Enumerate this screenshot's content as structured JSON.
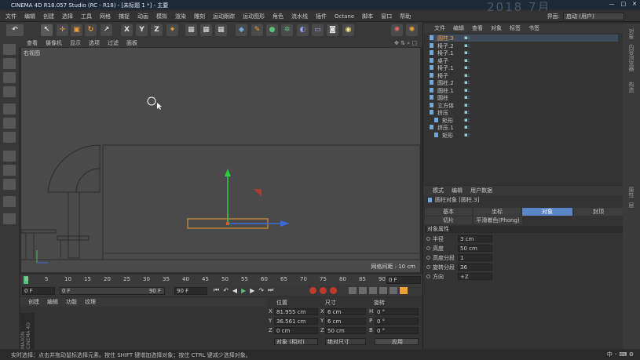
{
  "window": {
    "title": "CINEMA 4D R18.057 Studio (RC - R18) - [未标题 1 *] - 主要",
    "deco": "2018 7月"
  },
  "menu": [
    "文件",
    "编辑",
    "创建",
    "选择",
    "工具",
    "网格",
    "捕捉",
    "动画",
    "模拟",
    "渲染",
    "雕刻",
    "运动跟踪",
    "运动图形",
    "角色",
    "流水线",
    "插件",
    "Octane",
    "脚本",
    "窗口",
    "帮助"
  ],
  "layout": {
    "label": "界面:",
    "value": "启动 (用户)"
  },
  "toolbar_letters": [
    "X",
    "Y",
    "Z"
  ],
  "viewport": {
    "menu": [
      "查看",
      "摄像机",
      "显示",
      "选项",
      "过滤",
      "面板"
    ],
    "name": "右视图",
    "grid_info": "网格间距 : 10 cm"
  },
  "timeline": {
    "ticks": [
      "0",
      "5",
      "10",
      "15",
      "20",
      "25",
      "30",
      "35",
      "40",
      "45",
      "50",
      "55",
      "60",
      "65",
      "70",
      "75",
      "80",
      "85",
      "90"
    ],
    "current": "0 F",
    "start": "0 F",
    "slider_start": "0 F",
    "slider_end": "90 F",
    "end": "90 F"
  },
  "materials": {
    "menu": [
      "创建",
      "编辑",
      "功能",
      "纹理"
    ]
  },
  "coords": {
    "headers": [
      "位置",
      "尺寸",
      "旋转"
    ],
    "rows": [
      {
        "axis": "X",
        "pos": "81.955 cm",
        "size_axis": "X",
        "size": "6 cm",
        "rot_axis": "H",
        "rot": "0 °"
      },
      {
        "axis": "Y",
        "pos": "36.561 cm",
        "size_axis": "Y",
        "size": "6 cm",
        "rot_axis": "P",
        "rot": "0 °"
      },
      {
        "axis": "Z",
        "pos": "0 cm",
        "size_axis": "Z",
        "size": "50 cm",
        "rot_axis": "B",
        "rot": "0 °"
      }
    ],
    "mode": "对象 (相对)",
    "size_mode": "绝对尺寸",
    "apply": "应用"
  },
  "objects": {
    "menu": [
      "文件",
      "编辑",
      "查看",
      "对象",
      "标签",
      "书签"
    ],
    "items": [
      "圆柱.3",
      "椅子.2",
      "椅子.1",
      "桌子",
      "椅子.1",
      "椅子",
      "圆柱.2",
      "圆柱.1",
      "圆柱",
      "立方体",
      "挤压",
      "矩形",
      "挤压.1",
      "矩形"
    ]
  },
  "attributes": {
    "menu": [
      "模式",
      "编辑",
      "用户数据"
    ],
    "title": "圆柱对象 [圆柱.3]",
    "tabs": [
      "基本",
      "坐标",
      "对象",
      "封顶"
    ],
    "tabs2": [
      "切片",
      "平滑着色(Phong)"
    ],
    "active_tab": "对象",
    "section": "对象属性",
    "props": [
      {
        "label": "半径",
        "value": "3 cm"
      },
      {
        "label": "高度",
        "value": "50 cm"
      },
      {
        "label": "高度分段",
        "value": "1"
      },
      {
        "label": "旋转分段",
        "value": "36"
      },
      {
        "label": "方向",
        "value": "+Z"
      }
    ]
  },
  "side_strip": [
    "对象",
    "内容浏览器",
    "构造",
    "属性",
    "层"
  ],
  "brand": "MAXON CINEMA 4D",
  "status": "实时选择：点击并拖动鼠标选择元素。按住 SHIFT 键增加选择对象；按住 CTRL 键减少选择对象。",
  "colors": {
    "accent": "#5b86c7",
    "selection": "#f0a030",
    "axis_y": "#2ecc40",
    "axis_z": "#3a6ad4"
  }
}
